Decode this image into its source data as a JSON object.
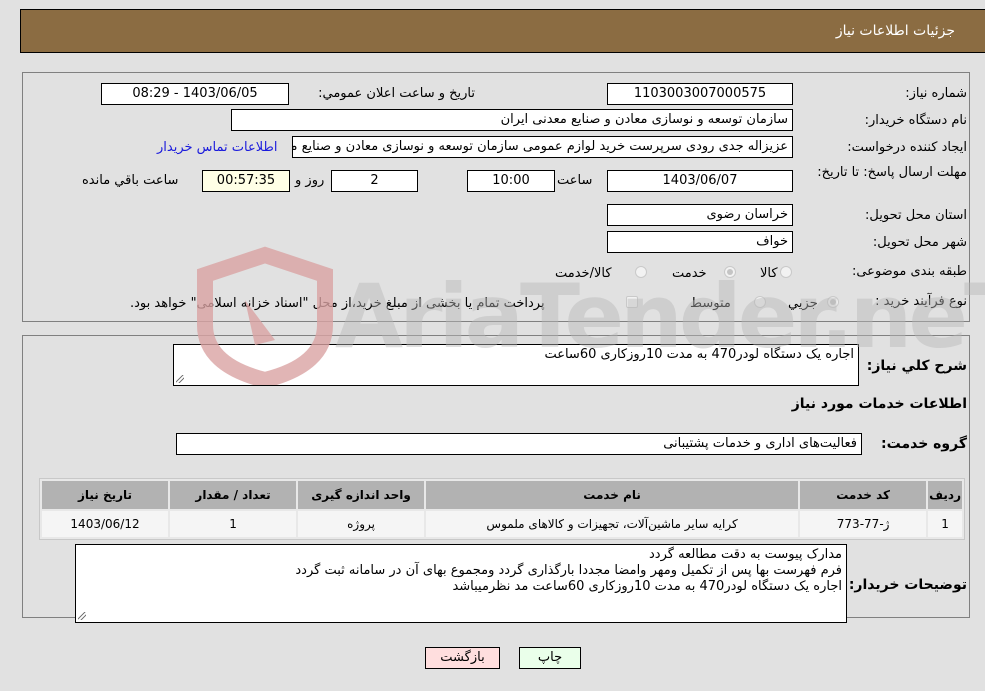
{
  "header": {
    "title": "جزئیات اطلاعات نیاز"
  },
  "form": {
    "need_number": {
      "label": "شماره نیاز:",
      "value": "1103003007000575"
    },
    "announce_datetime": {
      "label": "تاریخ و ساعت اعلان عمومي:",
      "value": "1403/06/05 - 08:29"
    },
    "buyer_org": {
      "label": "نام دستگاه خریدار:",
      "value": "سازمان توسعه و نوسازی معادن و صنایع معدنی ایران"
    },
    "requester": {
      "label": "ایجاد کننده درخواست:",
      "value": "عزیزاله جدی رودی سرپرست خرید لوازم عمومی  سازمان توسعه و نوسازی معادن و صنایع معدنی ایران"
    },
    "buyer_contact_link": "اطلاعات تماس خریدار",
    "deadline": {
      "label": "مهلت ارسال پاسخ: تا تاریخ:",
      "date": "1403/06/07",
      "time_label": "ساعت",
      "time": "10:00",
      "days": "2",
      "days_label": "روز و",
      "remaining": "00:57:35",
      "remaining_label": "ساعت باقي مانده"
    },
    "province": {
      "label": "استان محل تحویل:",
      "value": "خراسان رضوی"
    },
    "city": {
      "label": "شهر محل تحویل:",
      "value": "خواف"
    },
    "category": {
      "label": "طبقه بندی موضوعی:",
      "options": [
        "کالا",
        "خدمت",
        "کالا/خدمت"
      ],
      "selected": "خدمت"
    },
    "purchase_type": {
      "label": "نوع فرآیند خرید :",
      "options": [
        "جزيي",
        "متوسط"
      ],
      "selected": "جزيي",
      "treasury_note": "پرداخت تمام یا بخشی از مبلغ خرید،از محل \"اسناد خزانه اسلامی\" خواهد بود."
    }
  },
  "details": {
    "general_desc": {
      "label": "شرح کلي نياز:",
      "value": "اجاره یک دستگاه لودر470 به مدت 10روزکاری 60ساعت"
    },
    "services_heading": "اطلاعات خدمات مورد نیاز",
    "service_group": {
      "label": "گروه خدمت:",
      "value": "فعالیت‌های اداری و خدمات پشتیبانی"
    },
    "table": {
      "columns": [
        "ردیف",
        "کد خدمت",
        "نام خدمت",
        "واحد اندازه گیری",
        "تعداد / مقدار",
        "تاریخ نیاز"
      ],
      "rows": [
        [
          "1",
          "ژ-77-773",
          "کرایه سایر ماشین‌آلات، تجهیزات و کالاهای ملموس",
          "پروژه",
          "1",
          "1403/06/12"
        ]
      ]
    },
    "buyer_notes": {
      "label": "توضیحات خریدار:",
      "lines": [
        "مدارک پیوست به دقت مطالعه گردد",
        "فرم فهرست بها پس از تکمیل ومهر وامضا مجددا بارگذاری گردد ومجموع بهای آن در سامانه ثبت گردد",
        "اجاره یک دستگاه لودر470 به مدت 10روزکاری 60ساعت مد نظرمیباشد"
      ]
    }
  },
  "buttons": {
    "print": "چاپ",
    "back": "بازگشت"
  },
  "watermark": {
    "text": "AriaTender.neT"
  }
}
